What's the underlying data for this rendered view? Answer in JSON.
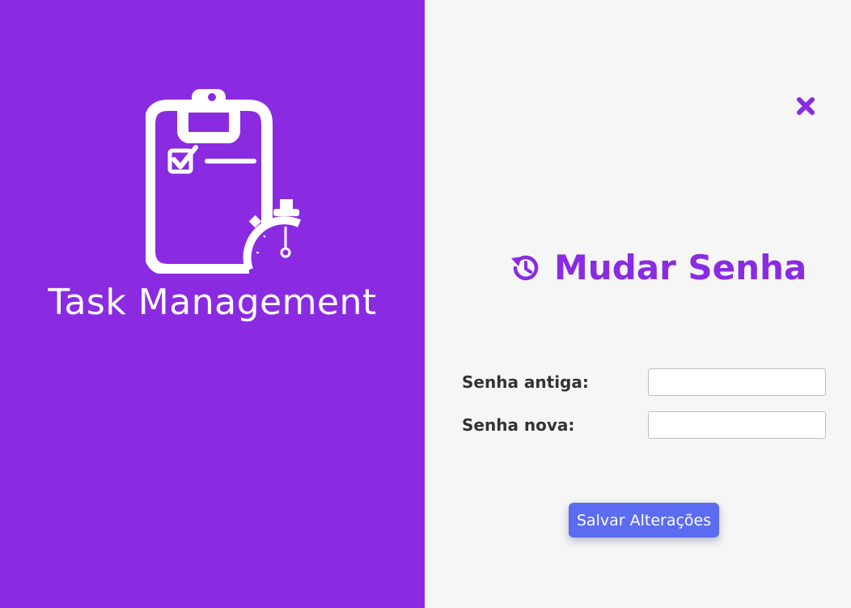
{
  "brand": {
    "app_name": "Task Management",
    "logo_icon": "clipboard-stopwatch-icon",
    "panel_color": "#8A2BE2"
  },
  "dialog": {
    "close_icon": "close-x-icon",
    "title": "Mudar Senha",
    "title_icon": "history-reset-icon",
    "accent_color": "#8A2BE2",
    "fields": [
      {
        "label": "Senha antiga:",
        "value": "",
        "placeholder": ""
      },
      {
        "label": "Senha nova:",
        "value": "",
        "placeholder": ""
      }
    ],
    "save_label": "Salvar Alterações",
    "save_color": "#5B6CF0"
  }
}
